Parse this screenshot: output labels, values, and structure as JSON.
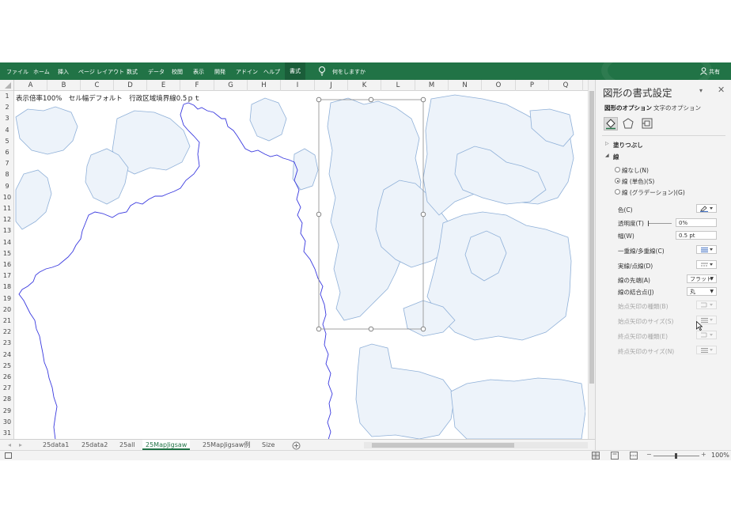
{
  "ribbon": {
    "tabs": [
      "ファイル",
      "ホーム",
      "挿入",
      "ページ レイアウト",
      "数式",
      "データ",
      "校閲",
      "表示",
      "開発",
      "アドイン",
      "ヘルプ",
      "書式"
    ],
    "tell_me": "何をしますか",
    "share": "共有",
    "accent": "#217346"
  },
  "columns": [
    "A",
    "B",
    "C",
    "D",
    "E",
    "F",
    "G",
    "H",
    "I",
    "J",
    "K",
    "L",
    "M",
    "N",
    "O",
    "P",
    "Q"
  ],
  "rows": [
    "1",
    "2",
    "3",
    "4",
    "5",
    "6",
    "7",
    "8",
    "9",
    "10",
    "11",
    "12",
    "13",
    "14",
    "15",
    "16",
    "17",
    "18",
    "19",
    "20",
    "21",
    "22",
    "23",
    "24",
    "25",
    "26",
    "27",
    "28",
    "29",
    "30",
    "31"
  ],
  "sheet": {
    "caption": "表示倍率100%　セル幅デフォルト　行政区域境界線0.5ｐｔ"
  },
  "sheet_tabs": [
    "25data1",
    "25data2",
    "25all",
    "25MapJigsaw",
    "25MapJigsaw例",
    "Size"
  ],
  "active_sheet": "25MapJigsaw",
  "status": {
    "zoom": "100%"
  },
  "pane": {
    "title": "図形の書式設定",
    "tab_shape": "図形のオプション",
    "tab_text": "文字のオプション",
    "section_fill": "塗りつぶし",
    "section_line": "線",
    "radio_none": "線なし(N)",
    "radio_solid": "線 (単色)(S)",
    "radio_gradient": "線 (グラデーション)(G)",
    "color": "色(C)",
    "transparency": "透明度(T)",
    "transparency_value": "0%",
    "width": "幅(W)",
    "width_value": "0.5 pt",
    "compound": "一重線/多重線(C)",
    "dash": "実線/点線(D)",
    "cap": "線の先端(A)",
    "cap_value": "フラット",
    "join": "線の結合点(J)",
    "join_value": "丸",
    "begin_arrow_type": "始点矢印の種類(B)",
    "begin_arrow_size": "始点矢印のサイズ(S)",
    "end_arrow_type": "終点矢印の種類(E)",
    "end_arrow_size": "終点矢印のサイズ(N)"
  }
}
